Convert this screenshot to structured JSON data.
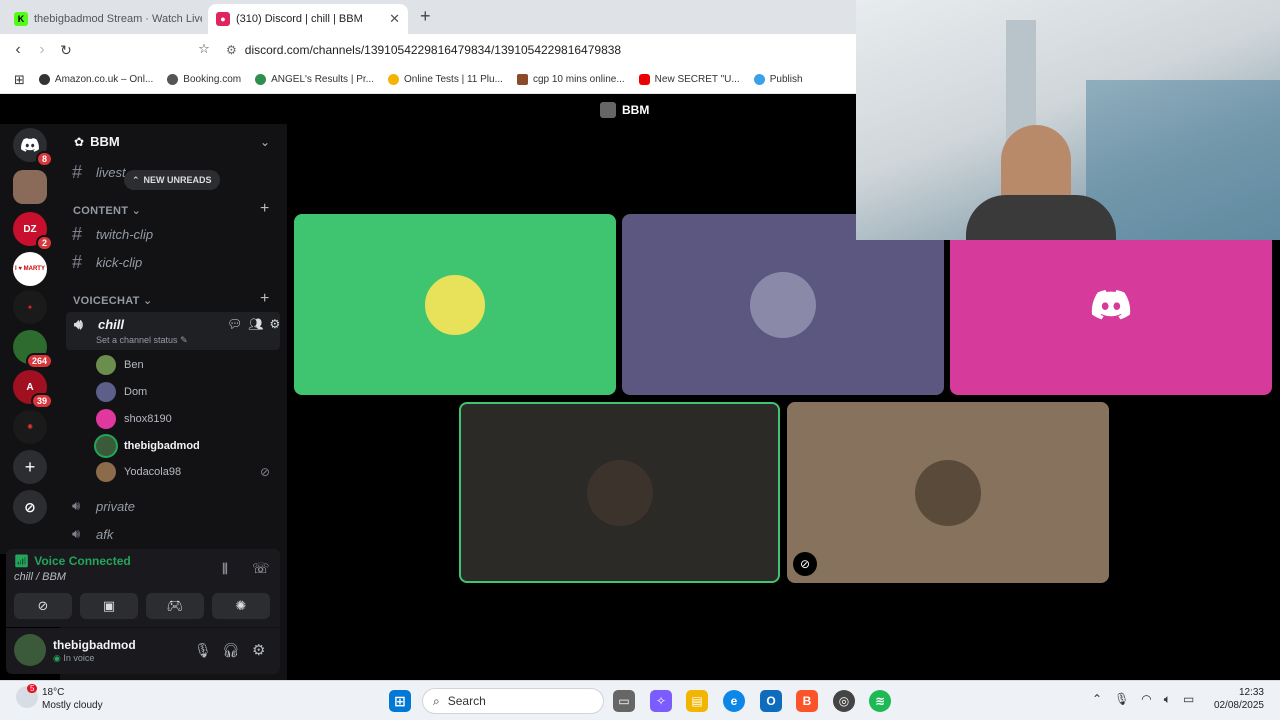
{
  "browser": {
    "tabs": [
      {
        "title": "thebigbadmod Stream · Watch Live"
      },
      {
        "title": "(310) Discord | chill | BBM"
      }
    ],
    "url": "discord.com/channels/1391054229816479834/1391054229816479838",
    "bookmarks": [
      "Amazon.co.uk – Onl...",
      "Booking.com",
      "ANGEL's Results | Pr...",
      "Online Tests | 11 Plu...",
      "cgp 10 mins online...",
      "New SECRET \"U...",
      "Publish"
    ]
  },
  "discord": {
    "header_title": "BBM",
    "server_name": "BBM",
    "guild_badges": [
      "8",
      "2",
      "264",
      "39"
    ],
    "guild_labels": {
      "marty": "I ♥ MARTY"
    },
    "new_unreads": "NEW UNREADS",
    "channels_top": [
      {
        "name": "livest"
      }
    ],
    "categories": [
      {
        "name": "CONTENT",
        "channels": [
          "twitch-clip",
          "kick-clip"
        ]
      },
      {
        "name": "VOICECHAT"
      }
    ],
    "voice_channel": {
      "name": "chill",
      "status_placeholder": "Set a channel status"
    },
    "members": [
      {
        "name": "Ben",
        "color": "#6b8e4e"
      },
      {
        "name": "Dom",
        "color": "#5b5f8a"
      },
      {
        "name": "shox8190",
        "color": "#e0389e"
      },
      {
        "name": "thebigbadmod",
        "color": "#3a5a3a"
      },
      {
        "name": "Yodacola98",
        "color": "#8b6b4a"
      }
    ],
    "other_voice": [
      "private",
      "afk"
    ],
    "voice_panel": {
      "status": "Voice Connected",
      "location": "chill / BBM"
    },
    "user": {
      "name": "thebigbadmod",
      "status": "In voice"
    },
    "tiles": [
      {
        "color": "#3fc56f"
      },
      {
        "color": "#5b5780"
      },
      {
        "color": "#d63a9a"
      },
      {
        "color": "#2b2a26",
        "speaking": true
      },
      {
        "color": "#87725e",
        "muted": true
      }
    ]
  },
  "taskbar": {
    "weather": {
      "temp": "18°C",
      "desc": "Mostly cloudy",
      "badge": "5"
    },
    "search_placeholder": "Search",
    "time": "12:33",
    "date": "02/08/2025"
  }
}
